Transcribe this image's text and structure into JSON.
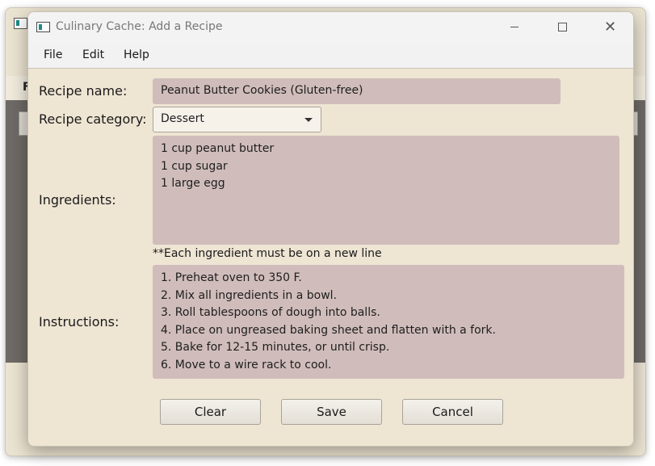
{
  "background_window": {
    "menu_letter": "F"
  },
  "window": {
    "title": "Culinary Cache: Add a Recipe",
    "controls": {
      "minimize": "—",
      "maximize": "□",
      "close": "✕"
    }
  },
  "menu": {
    "file": "File",
    "edit": "Edit",
    "help": "Help"
  },
  "form": {
    "recipe_name_label": "Recipe name:",
    "recipe_name_value": "Peanut Butter Cookies (Gluten-free)",
    "category_label": "Recipe category:",
    "category_value": "Dessert",
    "ingredients_label": "Ingredients:",
    "ingredients": [
      "1 cup peanut butter",
      "1 cup sugar",
      "1 large egg"
    ],
    "ingredients_note": "**Each ingredient must be on a new line",
    "instructions_label": "Instructions:",
    "instructions": [
      "1. Preheat oven to 350 F.",
      "2. Mix all ingredients in a bowl.",
      "3. Roll tablespoons of dough into balls.",
      "4. Place on ungreased baking sheet and flatten with a fork.",
      "5. Bake for 12-15 minutes, or until crisp.",
      "6. Move to a wire rack to cool."
    ]
  },
  "buttons": {
    "clear": "Clear",
    "save": "Save",
    "cancel": "Cancel"
  },
  "colors": {
    "dialog_background": "#eee5d3",
    "field_background": "#d0bdbb",
    "background_dark_panel": "#6e6a66"
  }
}
